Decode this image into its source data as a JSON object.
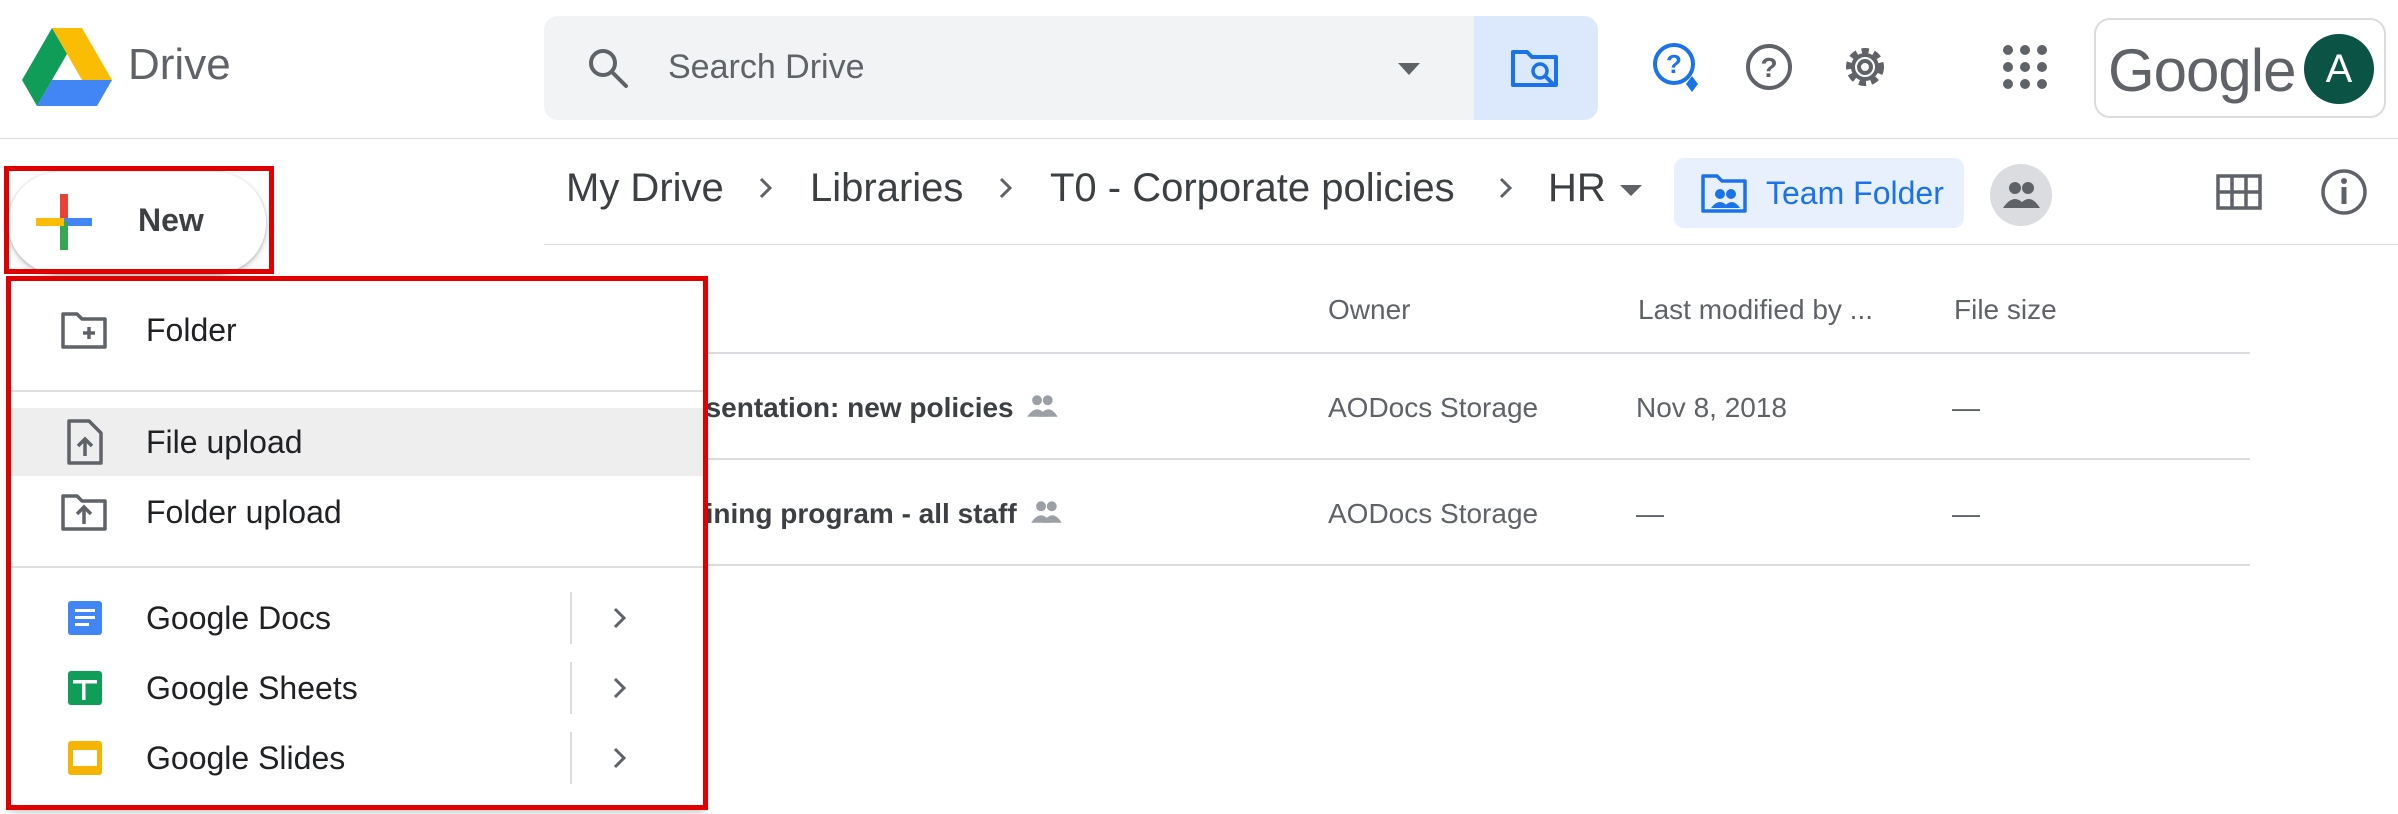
{
  "app": {
    "name": "Drive"
  },
  "search": {
    "placeholder": "Search Drive"
  },
  "account": {
    "brand": "Google",
    "avatar_letter": "A",
    "avatar_color": "#0b5345"
  },
  "breadcrumb": {
    "items": [
      "My Drive",
      "Libraries",
      "T0 - Corporate policies",
      "HR"
    ],
    "team_folder_label": "Team Folder"
  },
  "new_button": {
    "label": "New"
  },
  "new_menu": {
    "items": [
      {
        "label": "Folder",
        "icon": "folder-plus-icon"
      },
      {
        "label": "File upload",
        "icon": "file-upload-icon",
        "highlighted": true
      },
      {
        "label": "Folder upload",
        "icon": "folder-upload-icon"
      },
      {
        "label": "Google Docs",
        "icon": "google-docs-icon",
        "submenu": true
      },
      {
        "label": "Google Sheets",
        "icon": "google-sheets-icon",
        "submenu": true
      },
      {
        "label": "Google Slides",
        "icon": "google-slides-icon",
        "submenu": true
      }
    ]
  },
  "file_list": {
    "columns": [
      "Owner",
      "Last modified by ...",
      "File size"
    ],
    "rows": [
      {
        "name": "esentation: new policies",
        "owner": "AODocs Storage",
        "modified": "Nov 8, 2018",
        "size": "—"
      },
      {
        "name": "aining program - all staff",
        "owner": "AODocs Storage",
        "modified": "—",
        "size": "—"
      }
    ]
  },
  "colors": {
    "highlight": "#e00000",
    "accent_blue": "#1a73e8",
    "chip_bg": "#e8f0fe"
  }
}
